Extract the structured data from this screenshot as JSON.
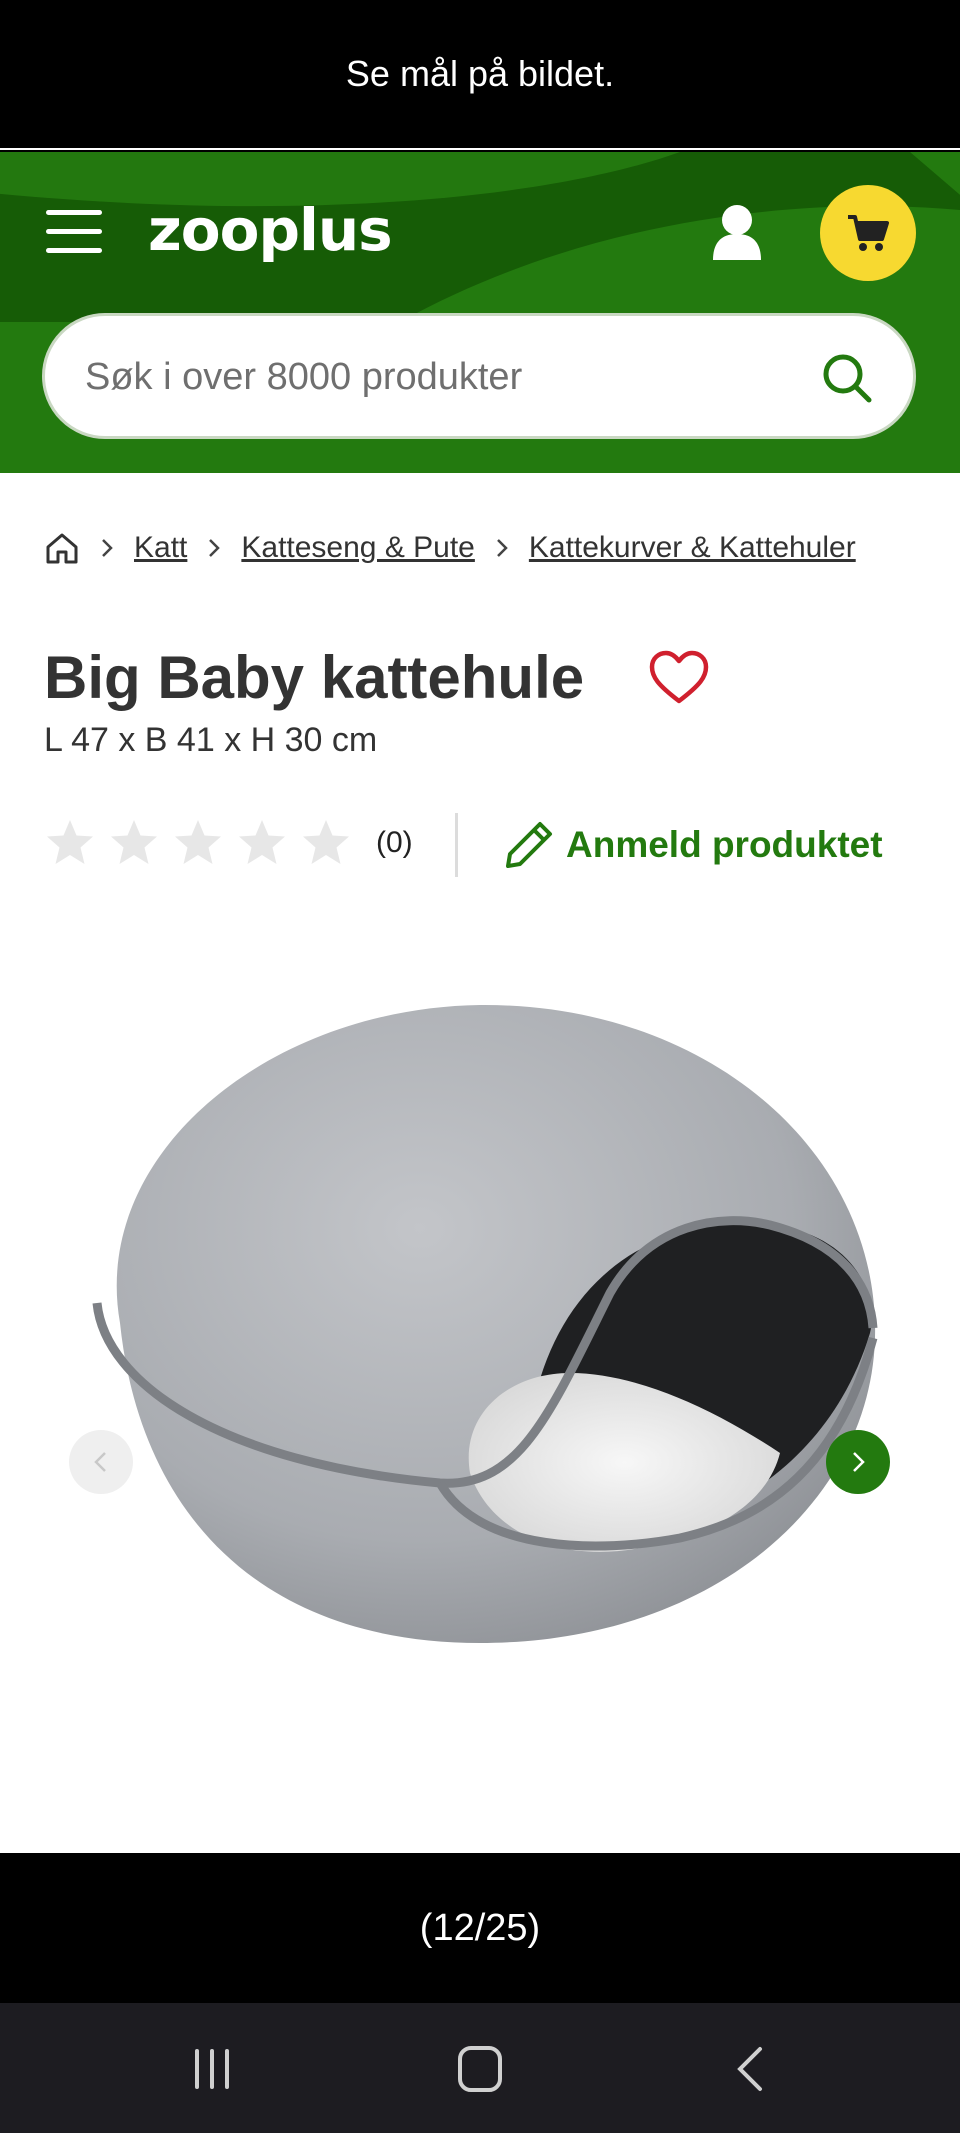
{
  "caption": "Se mål på bildet.",
  "header": {
    "logo_text": "zooplus",
    "search_placeholder": "Søk i over 8000 produkter",
    "brand_green": "#237a0f",
    "cart_yellow": "#f7d930"
  },
  "breadcrumb": {
    "home_icon": "home-icon",
    "items": [
      "Katt",
      "Katteseng & Pute",
      "Kattekurver & Kattehuler"
    ]
  },
  "product": {
    "title": "Big Baby kattehule",
    "dimensions": "L 47 x B 41 x H 30 cm",
    "rating": {
      "stars": 0,
      "max": 5,
      "count_label": "(0)"
    },
    "review_label": "Anmeld produktet",
    "favorite_icon": "heart-icon"
  },
  "gallery": {
    "counter": "(12/25)",
    "current": 12,
    "total": 25
  },
  "system_nav": [
    "recent-apps",
    "home",
    "back"
  ]
}
